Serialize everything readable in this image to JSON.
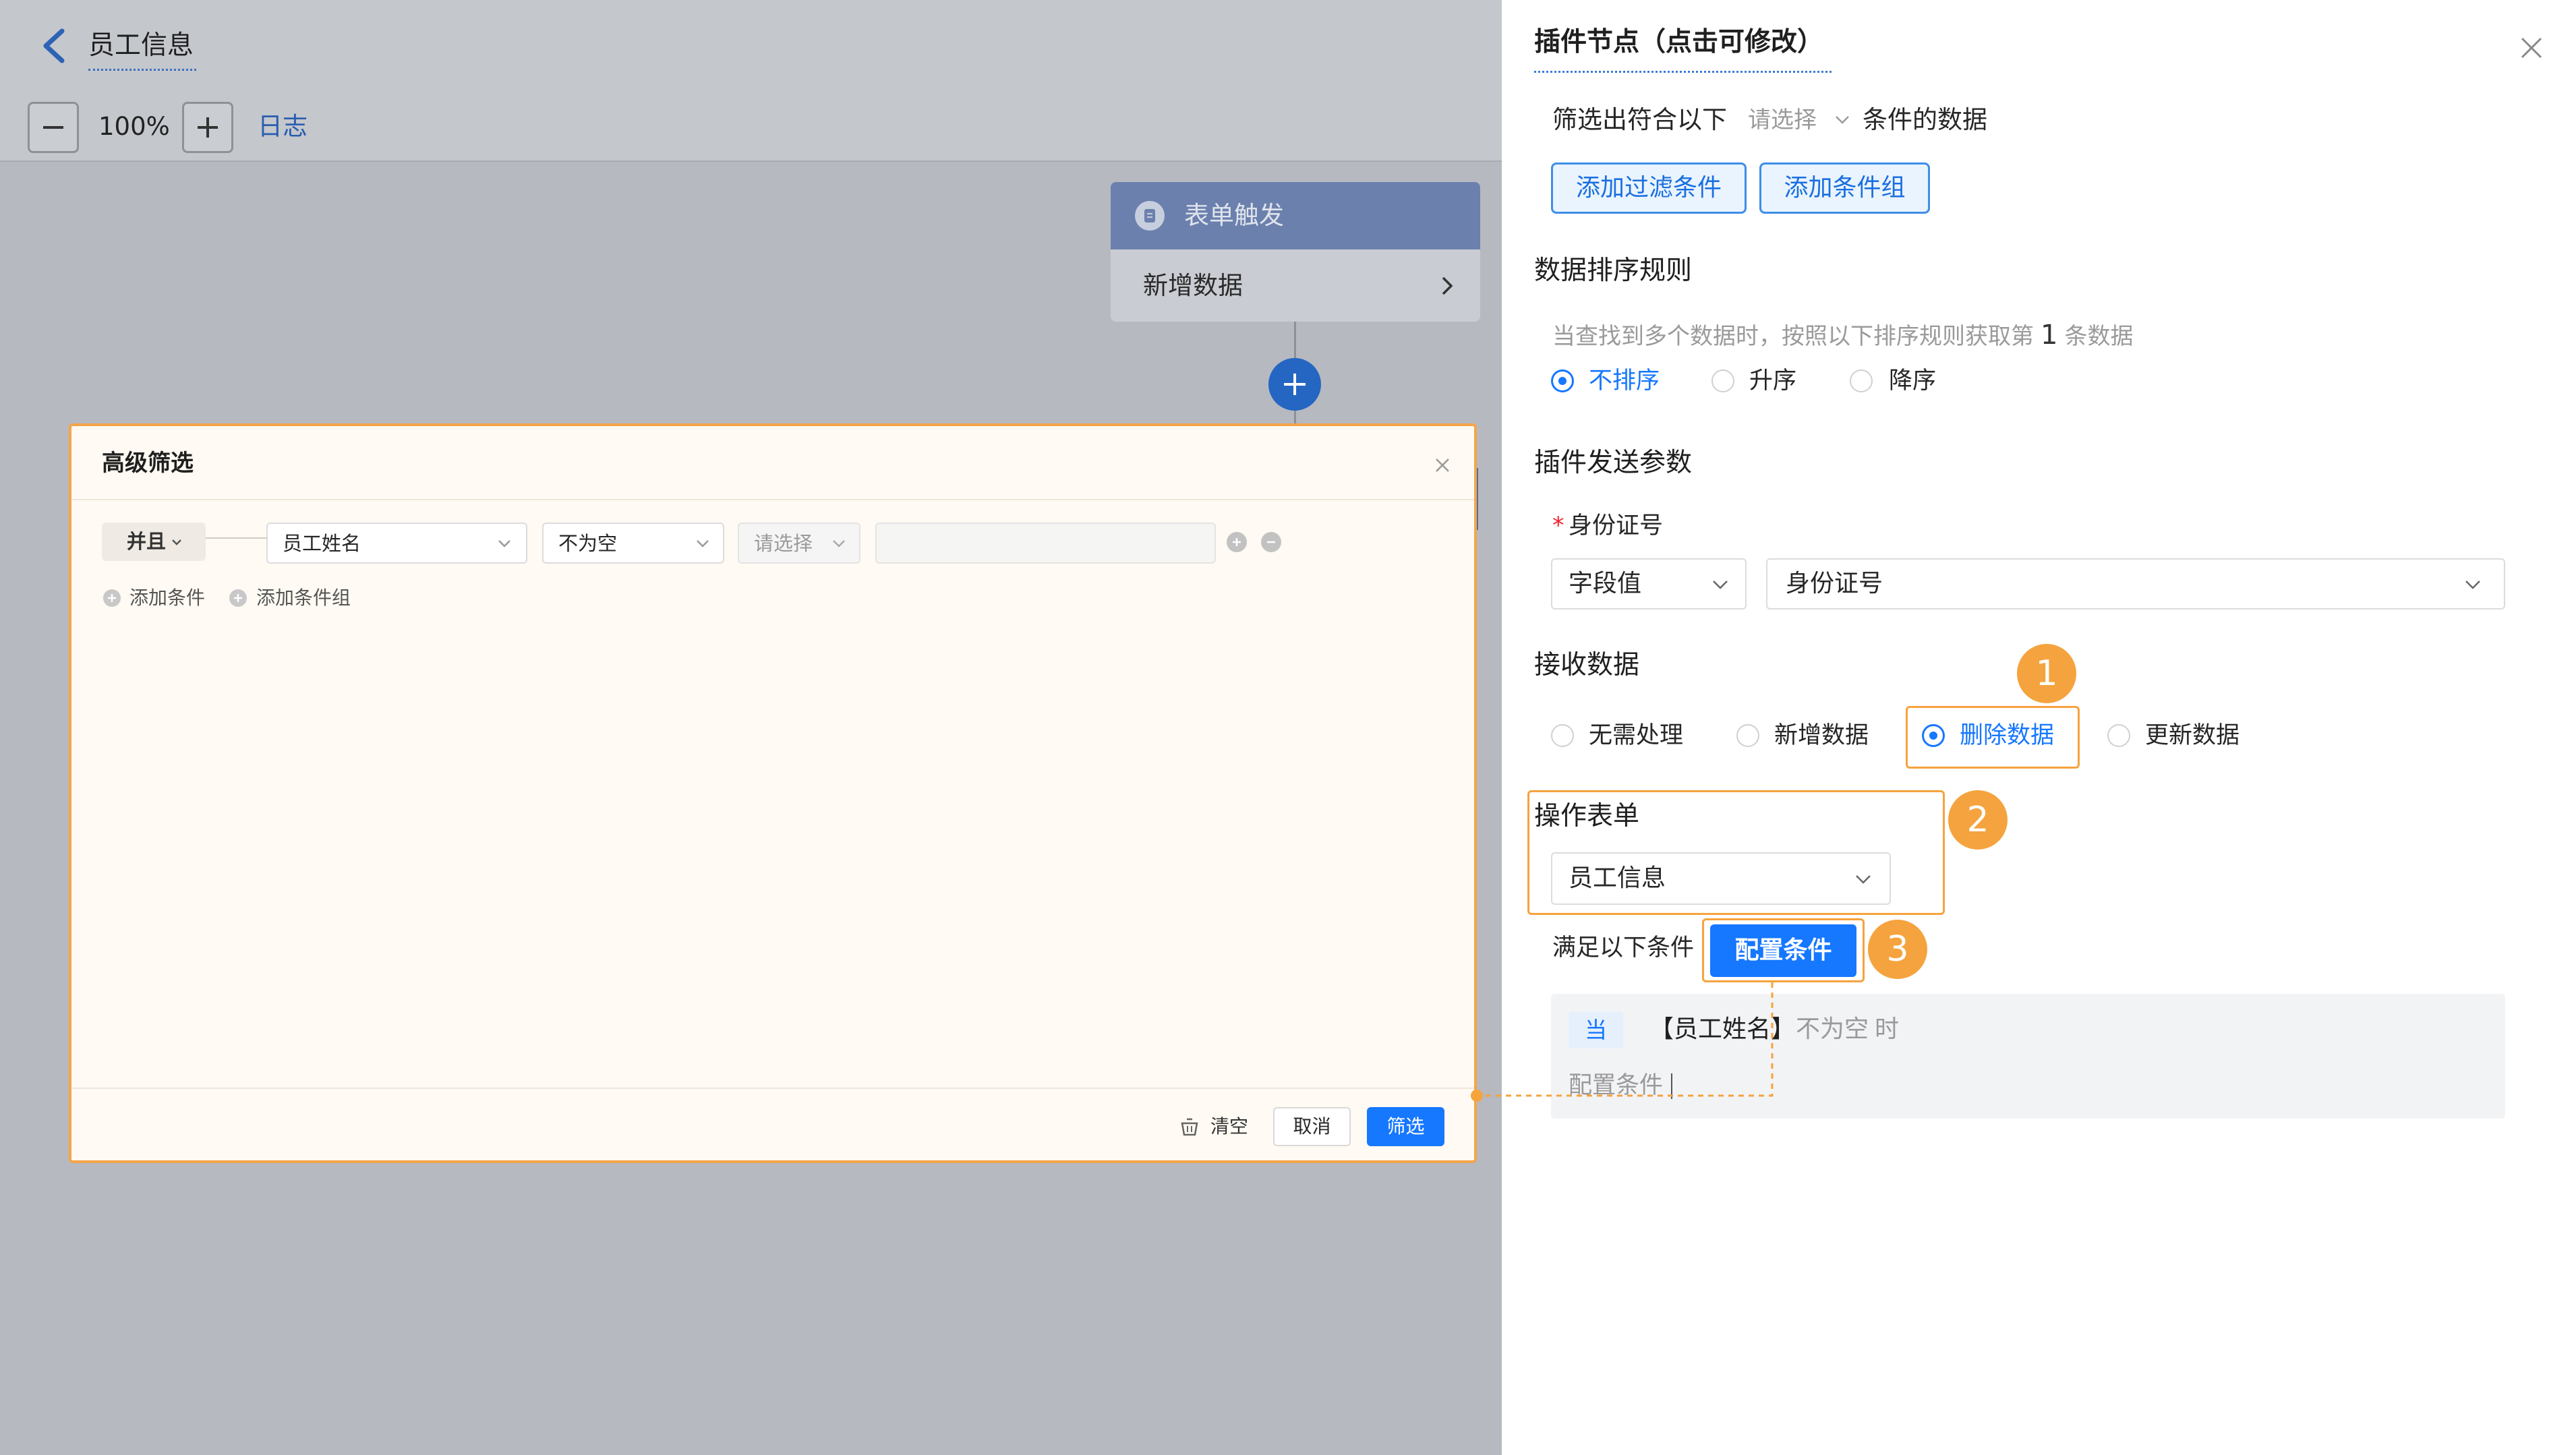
{
  "header": {
    "title": "员工信息",
    "zoom": "100%",
    "log_label": "日志"
  },
  "flow": {
    "trigger_title": "表单触发",
    "trigger_action": "新增数据"
  },
  "filter_modal": {
    "title": "高级筛选",
    "logic": "并且",
    "field": "员工姓名",
    "operator": "不为空",
    "value_placeholder": "请选择",
    "add_condition": "添加条件",
    "add_group": "添加条件组",
    "clear_label": "清空",
    "cancel_label": "取消",
    "submit_label": "筛选"
  },
  "panel": {
    "title": "插件节点（点击可修改）",
    "filter_prefix": "筛选出符合以下",
    "filter_select": "请选择",
    "filter_suffix": "条件的数据",
    "add_filter": "添加过滤条件",
    "add_group": "添加条件组",
    "sort_title": "数据排序规则",
    "sort_desc_prefix": "当查找到多个数据时，按照以下排序规则获取第",
    "sort_count": "1",
    "sort_desc_suffix": "条数据",
    "sort_options": [
      {
        "label": "不排序",
        "selected": true
      },
      {
        "label": "升序",
        "selected": false
      },
      {
        "label": "降序",
        "selected": false
      }
    ],
    "send_title": "插件发送参数",
    "param_required": "*",
    "param_label": "身份证号",
    "param_type": "字段值",
    "param_value": "身份证号",
    "receive_title": "接收数据",
    "receive_options": [
      {
        "label": "无需处理",
        "selected": false
      },
      {
        "label": "新增数据",
        "selected": false
      },
      {
        "label": "删除数据",
        "selected": true
      },
      {
        "label": "更新数据",
        "selected": false
      }
    ],
    "form_title": "操作表单",
    "form_value": "员工信息",
    "condition_label": "满足以下条件",
    "config_button": "配置条件",
    "condition_when": "当",
    "condition_field": "【员工姓名】",
    "condition_op": "不为空",
    "condition_then": "时",
    "condition_input": "配置条件"
  },
  "annotations": {
    "badges": [
      "1",
      "2",
      "3"
    ]
  },
  "colors": {
    "primary": "#1677ff",
    "annotation_orange": "#f5a33e",
    "overlay_gray": "#b6b9c0",
    "node_header": "#6b80ad"
  }
}
